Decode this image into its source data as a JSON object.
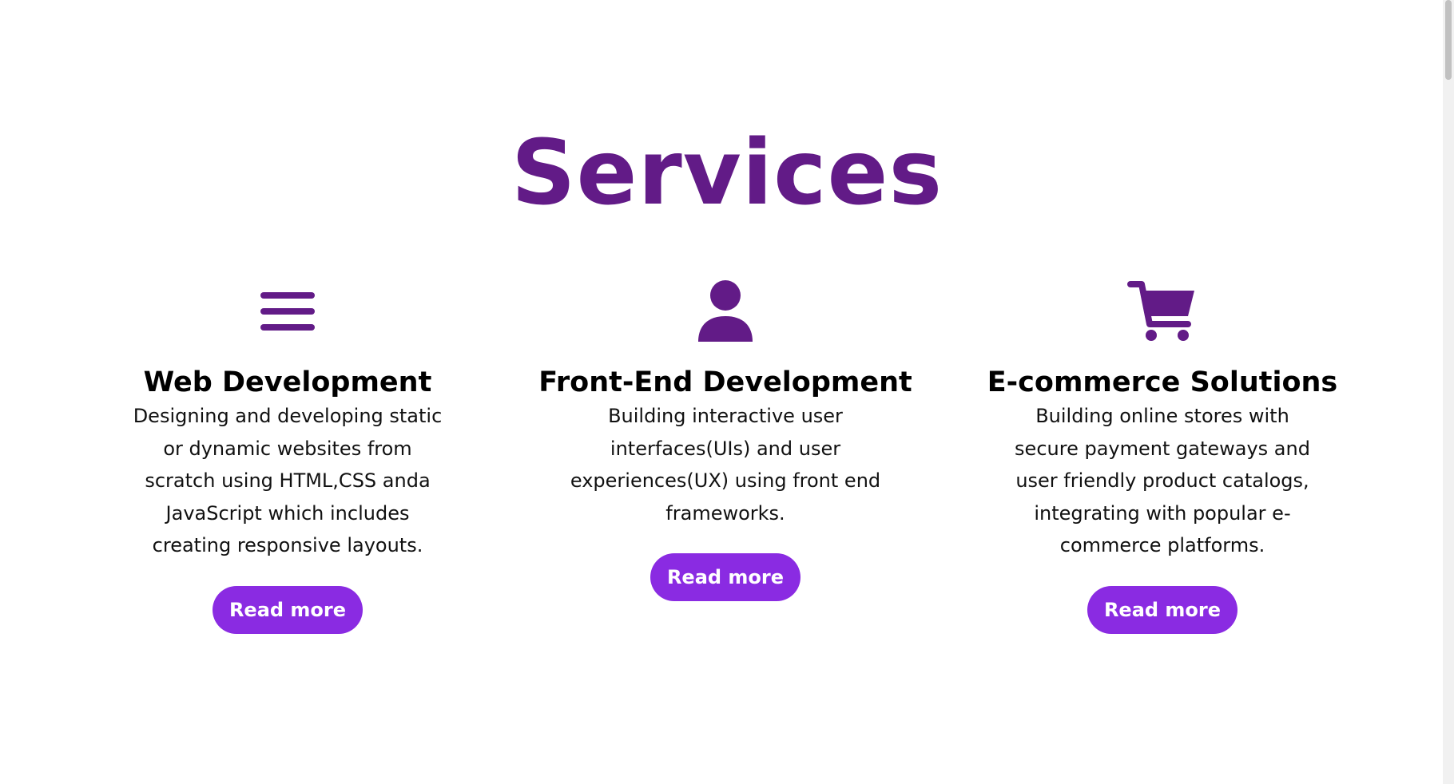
{
  "page": {
    "title": "Services"
  },
  "colors": {
    "title": "#621b87",
    "icon": "#621b87",
    "button_bg": "#8a2be2",
    "button_text": "#ffffff"
  },
  "services": [
    {
      "icon": "menu-bars-icon",
      "title": "Web Development",
      "description": "Designing and developing static or dynamic websites from scratch using HTML,CSS anda JavaScript which includes creating responsive layouts.",
      "button_label": "Read more"
    },
    {
      "icon": "user-icon",
      "title": "Front-End Development",
      "description": "Building interactive user interfaces(UIs) and user experiences(UX) using front end frameworks.",
      "button_label": "Read more"
    },
    {
      "icon": "shopping-cart-icon",
      "title": "E-commerce Solutions",
      "description": "Building online stores with secure payment gateways and user friendly product catalogs, integrating with popular e-commerce platforms.",
      "button_label": "Read more"
    }
  ]
}
